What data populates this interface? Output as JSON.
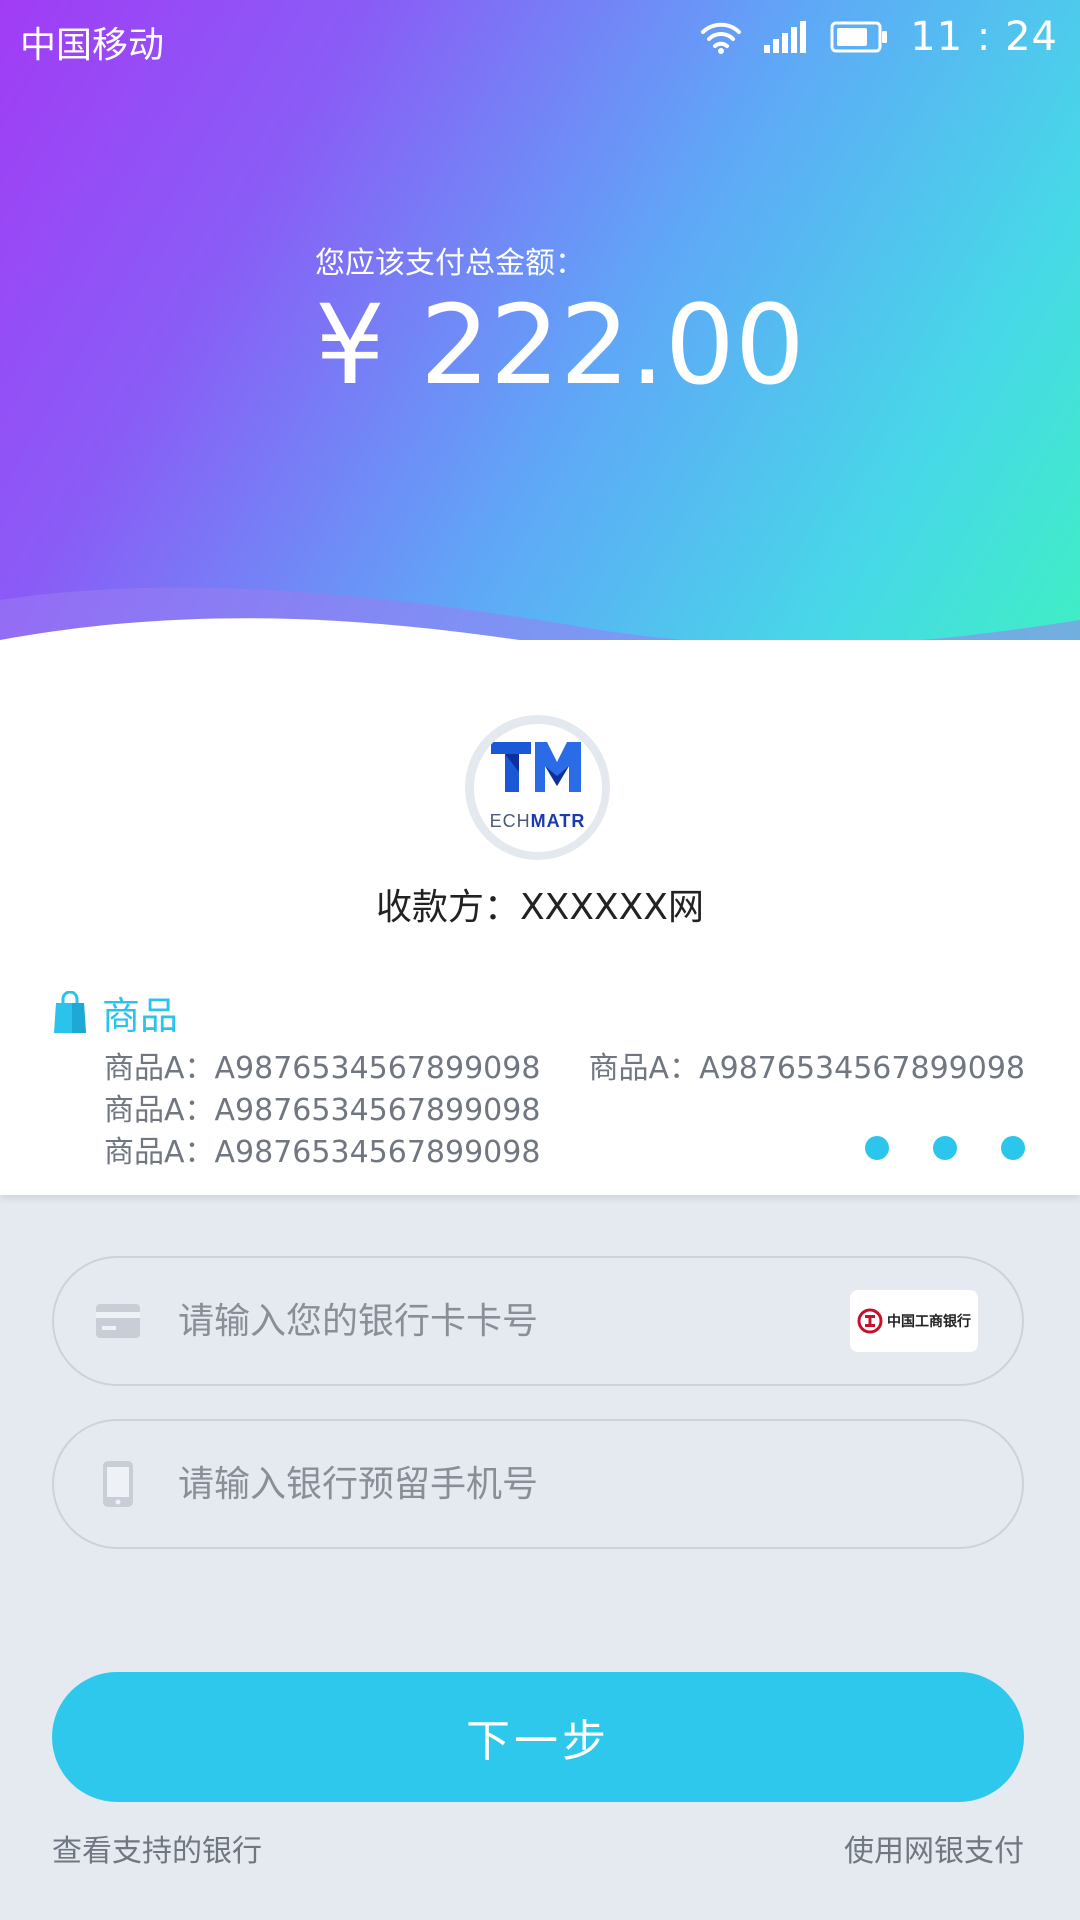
{
  "status_bar": {
    "carrier": "中国移动",
    "time": "11 : 24",
    "wifi_icon": "wifi-icon",
    "signal_icon": "signal-icon",
    "battery_icon": "battery-icon"
  },
  "payment": {
    "label": "您应该支付总金额：",
    "amount": "¥ 222.00"
  },
  "merchant": {
    "logo_text_light": "ECH",
    "logo_text_bold": "MATR",
    "payee": "收款方：XXXXXX网"
  },
  "goods": {
    "title": "商品",
    "icon": "shopping-bag-icon",
    "items_left": [
      "商品A：A9876534567899098",
      "商品A：A9876534567899098",
      "商品A：A9876534567899098"
    ],
    "items_right": [
      "商品A：A9876534567899098"
    ]
  },
  "form": {
    "card_placeholder": "请输入您的银行卡卡号",
    "card_value": "",
    "card_icon": "credit-card-icon",
    "bank_name": "中国工商银行",
    "phone_placeholder": "请输入银行预留手机号",
    "phone_value": "",
    "phone_icon": "phone-icon"
  },
  "actions": {
    "next": "下一步",
    "supported_banks": "查看支持的银行",
    "online_banking": "使用网银支付"
  },
  "colors": {
    "accent": "#2ec8ec",
    "gradient_start": "#a13cf5",
    "gradient_end": "#3ef1c0",
    "bank_red": "#c8102e"
  }
}
